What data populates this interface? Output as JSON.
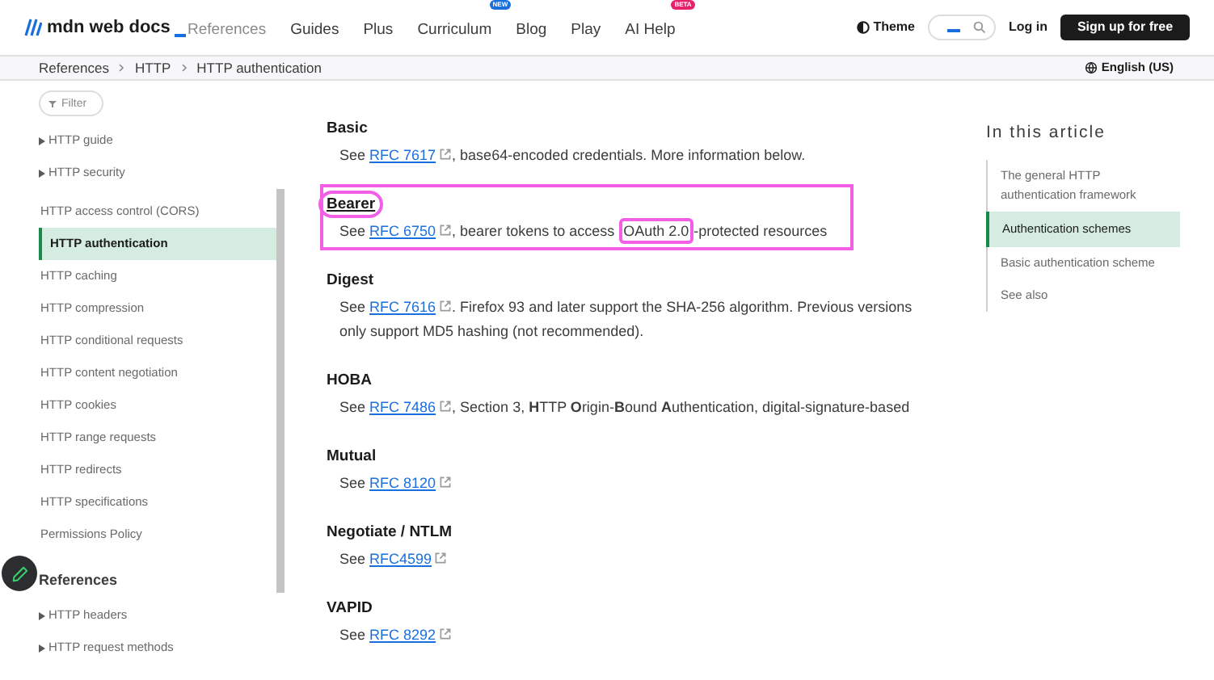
{
  "header": {
    "logo": "mdn web docs",
    "nav": [
      {
        "label": "References",
        "selected": true
      },
      {
        "label": "Guides",
        "selected": false
      },
      {
        "label": "Plus",
        "selected": false
      },
      {
        "label": "Curriculum",
        "badge": "NEW",
        "color": "#1a6fdf",
        "selected": false
      },
      {
        "label": "Blog",
        "selected": false
      },
      {
        "label": "Play",
        "selected": false
      },
      {
        "label": "AI Help",
        "badge": "BETA",
        "color": "#e8216c",
        "selected": false
      }
    ],
    "theme": "Theme",
    "login": "Log in",
    "signup": "Sign up for free"
  },
  "breadcrumbs": [
    "References",
    "HTTP",
    "HTTP authentication"
  ],
  "language": "English (US)",
  "sidebar": {
    "filter": {
      "placeholder": "Filter"
    },
    "items": [
      {
        "kind": "group",
        "label": "HTTP guide",
        "selected": false
      },
      {
        "kind": "group",
        "label": "HTTP security",
        "selected": false
      },
      {
        "kind": "link",
        "label": "HTTP access control (CORS)",
        "selected": false
      },
      {
        "kind": "link",
        "label": "HTTP authentication",
        "selected": true
      },
      {
        "kind": "link",
        "label": "HTTP caching",
        "selected": false
      },
      {
        "kind": "link",
        "label": "HTTP compression",
        "selected": false
      },
      {
        "kind": "link",
        "label": "HTTP conditional requests",
        "selected": false
      },
      {
        "kind": "link",
        "label": "HTTP content negotiation",
        "selected": false
      },
      {
        "kind": "link",
        "label": "HTTP cookies",
        "selected": false
      },
      {
        "kind": "link",
        "label": "HTTP range requests",
        "selected": false
      },
      {
        "kind": "link",
        "label": "HTTP redirects",
        "selected": false
      },
      {
        "kind": "link",
        "label": "HTTP specifications",
        "selected": false
      },
      {
        "kind": "link",
        "label": "Permissions Policy",
        "selected": false
      },
      {
        "kind": "heading",
        "label": "References",
        "selected": false
      },
      {
        "kind": "group",
        "label": "HTTP headers",
        "selected": false
      },
      {
        "kind": "group",
        "label": "HTTP request methods",
        "selected": false
      }
    ]
  },
  "sections": [
    {
      "title": "Basic",
      "underlined": false,
      "boxed": false,
      "circled": false,
      "parts": [
        {
          "kind": "text",
          "text": "See "
        },
        {
          "kind": "link",
          "text": "RFC 7617"
        },
        {
          "kind": "text",
          "text": ", base64-encoded credentials. More information below."
        }
      ]
    },
    {
      "title": "Bearer",
      "underlined": true,
      "boxed": true,
      "circled": true,
      "parts": [
        {
          "kind": "text",
          "text": "See "
        },
        {
          "kind": "link",
          "text": "RFC 6750"
        },
        {
          "kind": "text",
          "text": ", bearer tokens to access "
        },
        {
          "kind": "marked",
          "text": "OAuth 2.0"
        },
        {
          "kind": "text",
          "text": "-protected resources"
        }
      ]
    },
    {
      "title": "Digest",
      "underlined": false,
      "boxed": false,
      "circled": false,
      "parts": [
        {
          "kind": "text",
          "text": "See "
        },
        {
          "kind": "link",
          "text": "RFC 7616"
        },
        {
          "kind": "text",
          "text": ". Firefox 93 and later support the SHA-256 algorithm. Previous versions only support MD5 hashing (not recommended)."
        }
      ]
    },
    {
      "title": "HOBA",
      "underlined": false,
      "boxed": false,
      "circled": false,
      "parts": [
        {
          "kind": "text",
          "text": "See "
        },
        {
          "kind": "link",
          "text": "RFC 7486"
        },
        {
          "kind": "text",
          "text": ", Section 3, **H**TTP **O**rigin-**B**ound **A**uthentication, digital-signature-based"
        }
      ]
    },
    {
      "title": "Mutual",
      "underlined": false,
      "boxed": false,
      "circled": false,
      "parts": [
        {
          "kind": "text",
          "text": "See "
        },
        {
          "kind": "link",
          "text": "RFC 8120"
        }
      ]
    },
    {
      "title": "Negotiate / NTLM",
      "underlined": false,
      "boxed": false,
      "circled": false,
      "parts": [
        {
          "kind": "text",
          "text": "See "
        },
        {
          "kind": "link",
          "text": "RFC4599"
        }
      ]
    },
    {
      "title": "VAPID",
      "underlined": false,
      "boxed": false,
      "circled": false,
      "parts": [
        {
          "kind": "text",
          "text": "See "
        },
        {
          "kind": "link",
          "text": "RFC 8292"
        }
      ]
    }
  ],
  "toc": {
    "title": "In this article",
    "items": [
      {
        "label": "The general HTTP authentication framework",
        "selected": false
      },
      {
        "label": "Authentication schemes",
        "selected": true
      },
      {
        "label": "Basic authentication scheme",
        "selected": false
      },
      {
        "label": "See also",
        "selected": false
      }
    ]
  }
}
